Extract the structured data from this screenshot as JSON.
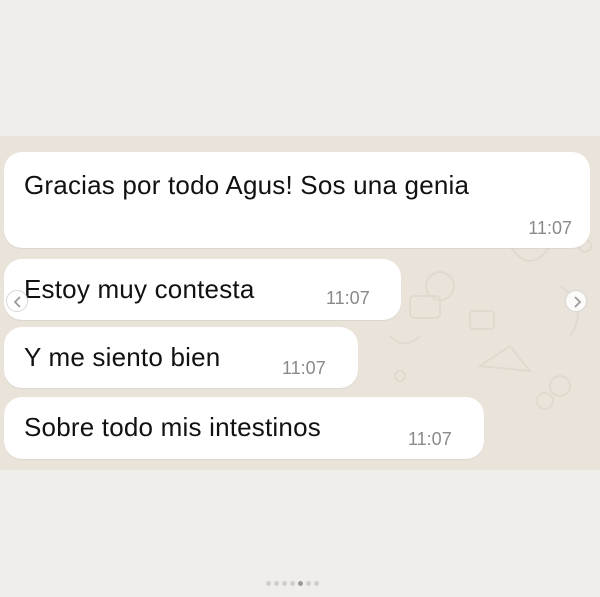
{
  "messages": [
    {
      "text": "Gracias por todo Agus! Sos una genia",
      "time": "11:07"
    },
    {
      "text": "Estoy muy contesta",
      "time": "11:07"
    },
    {
      "text": "Y me siento bien",
      "time": "11:07"
    },
    {
      "text": "Sobre todo mis intestinos",
      "time": "11:07"
    }
  ],
  "pagination": {
    "total": 7,
    "active_index": 4
  },
  "icons": {
    "next": "chevron-right-icon",
    "prev": "chevron-left-icon"
  },
  "colors": {
    "page_background": "#efeeea",
    "chat_background": "#e9e3da",
    "bubble": "#ffffff",
    "timestamp": "#8a8a8a"
  }
}
